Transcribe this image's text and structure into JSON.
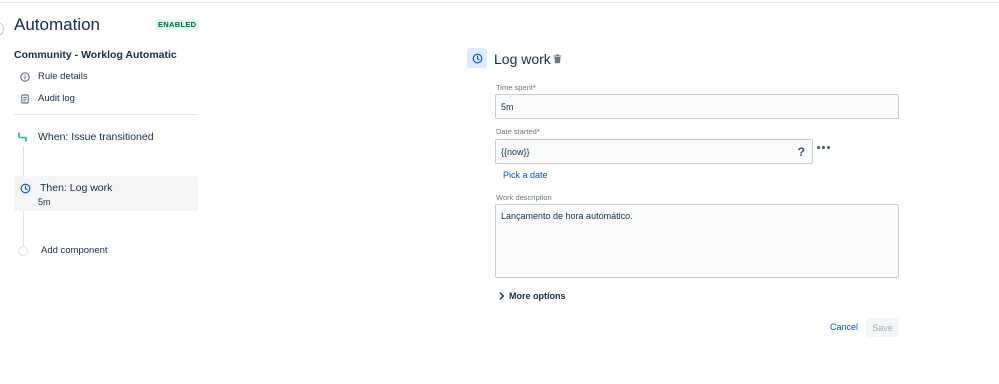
{
  "app": {
    "title": "Automation",
    "status_badge": "ENABLED"
  },
  "sidebar": {
    "rule_name": "Community - Worklog Automatic",
    "links": [
      {
        "label": "Rule details",
        "icon": "info-icon"
      },
      {
        "label": "Audit log",
        "icon": "clipboard-icon"
      }
    ],
    "steps": {
      "trigger": {
        "label": "When: Issue transitioned",
        "icon": "transition-icon"
      },
      "action": {
        "label": "Then: Log work",
        "sub": "5m",
        "icon": "clock-icon",
        "selected": true
      },
      "add": {
        "label": "Add component"
      }
    }
  },
  "panel": {
    "title": "Log work",
    "icon": "clock-icon",
    "time_spent": {
      "label": "Time spent",
      "required_mark": "*",
      "value": "5m"
    },
    "date_started": {
      "label": "Date started",
      "required_mark": "*",
      "value": "{{now}}",
      "help": "?"
    },
    "pick_date_link": "Pick a date",
    "work_description": {
      "label": "Work description",
      "value": "Lançamento de hora automático."
    },
    "more_options": "More options",
    "cancel_label": "Cancel",
    "save_label": "Save"
  },
  "colors": {
    "accent_blue": "#0052cc",
    "badge_green_bg": "#e3fcef",
    "badge_green_text": "#006644",
    "trigger_green": "#36b37e",
    "selected_bg": "#f4f5f7",
    "required_red": "#de350b"
  }
}
